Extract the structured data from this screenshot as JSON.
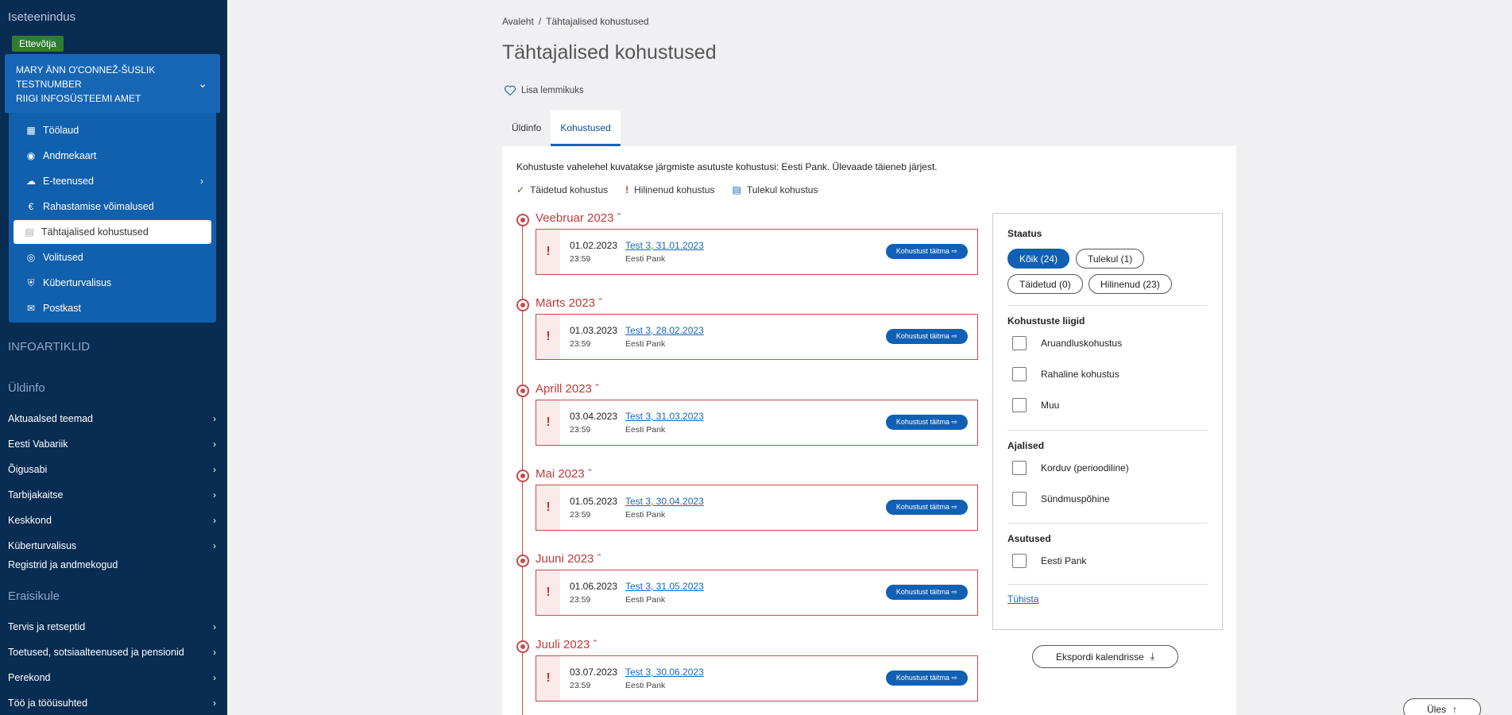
{
  "sidebar": {
    "title": "Iseteenindus",
    "role": "Ettevõtja",
    "account": {
      "line1": "MARY ÄNN O'CONNEŽ-ŠUSLIK",
      "line2": "TESTNUMBER",
      "line3": "RIIGI INFOSÜSTEEMI AMET"
    },
    "menu": [
      {
        "label": "Töölaud",
        "icon": "dashboard-icon"
      },
      {
        "label": "Andmekaart",
        "icon": "data-card-icon"
      },
      {
        "label": "E-teenused",
        "icon": "cloud-icon"
      },
      {
        "label": "Rahastamise võimalused",
        "icon": "euro-icon"
      },
      {
        "label": "Tähtajalised kohustused",
        "icon": "calendar-icon"
      },
      {
        "label": "Volitused",
        "icon": "globe-icon"
      },
      {
        "label": "Küberturvalisus",
        "icon": "shield-icon"
      },
      {
        "label": "Postkast",
        "icon": "mail-icon"
      }
    ],
    "section_info": "INFOARTIKLID",
    "section_general": "Üldinfo",
    "general_links": [
      "Aktuaalsed teemad",
      "Eesti Vabariik",
      "Õigusabi",
      "Tarbijakaitse",
      "Keskkond",
      "Küberturvalisus"
    ],
    "registries": "Registrid ja andmekogud",
    "section_private": "Eraisikule",
    "private_links": [
      "Tervis ja retseptid",
      "Toetused, sotsiaalteenused ja pensionid",
      "Perekond",
      "Töö ja tööüsuhted"
    ]
  },
  "breadcrumb": {
    "home": "Avaleht",
    "separator": "/",
    "current": "Tähtajalised kohustused"
  },
  "page_title": "Tähtajalised kohustused",
  "favorite_label": "Lisa lemmikuks",
  "tabs": [
    "Üldinfo",
    "Kohustused"
  ],
  "intro": "Kohustuste vahelehel kuvatakse järgmiste asutuste kohustusi: Eesti Pank. Ülevaade täieneb järjest.",
  "legend": {
    "done": "Täidetud kohustus",
    "late": "Hilinenud kohustus",
    "upcoming": "Tulekul kohustus"
  },
  "timeline": [
    {
      "month": "Veebruar 2023",
      "date": "01.02.2023",
      "time": "23:59",
      "title": "Test 3, 31.01.2023",
      "org": "Eesti Pank"
    },
    {
      "month": "Märts 2023",
      "date": "01.03.2023",
      "time": "23:59",
      "title": "Test 3, 28.02.2023",
      "org": "Eesti Pank"
    },
    {
      "month": "Aprill 2023",
      "date": "03.04.2023",
      "time": "23:59",
      "title": "Test 3, 31.03.2023",
      "org": "Eesti Pank"
    },
    {
      "month": "Mai 2023",
      "date": "01.05.2023",
      "time": "23:59",
      "title": "Test 3, 30.04.2023",
      "org": "Eesti Pank"
    },
    {
      "month": "Juuni 2023",
      "date": "01.06.2023",
      "time": "23:59",
      "title": "Test 3, 31.05.2023",
      "org": "Eesti Pank"
    },
    {
      "month": "Juuli 2023",
      "date": "03.07.2023",
      "time": "23:59",
      "title": "Test 3, 30.06.2023",
      "org": "Eesti Pank"
    }
  ],
  "fulfill_button": "Kohustust täitma",
  "filters": {
    "status_title": "Staatus",
    "status_chips": [
      "Kõik (24)",
      "Tulekul (1)",
      "Täidetud (0)",
      "Hilinenud (23)"
    ],
    "types_title": "Kohustuste liigid",
    "types": [
      "Aruandluskohustus",
      "Rahaline kohustus",
      "Muu"
    ],
    "timing_title": "Ajalised",
    "timing": [
      "Korduv (perioodiline)",
      "Sündmuspõhine"
    ],
    "orgs_title": "Asutused",
    "orgs": [
      "Eesti Pank"
    ],
    "cancel": "Tühista"
  },
  "export_label": "Ekspordi kalendrisse",
  "up_label": "Üles"
}
